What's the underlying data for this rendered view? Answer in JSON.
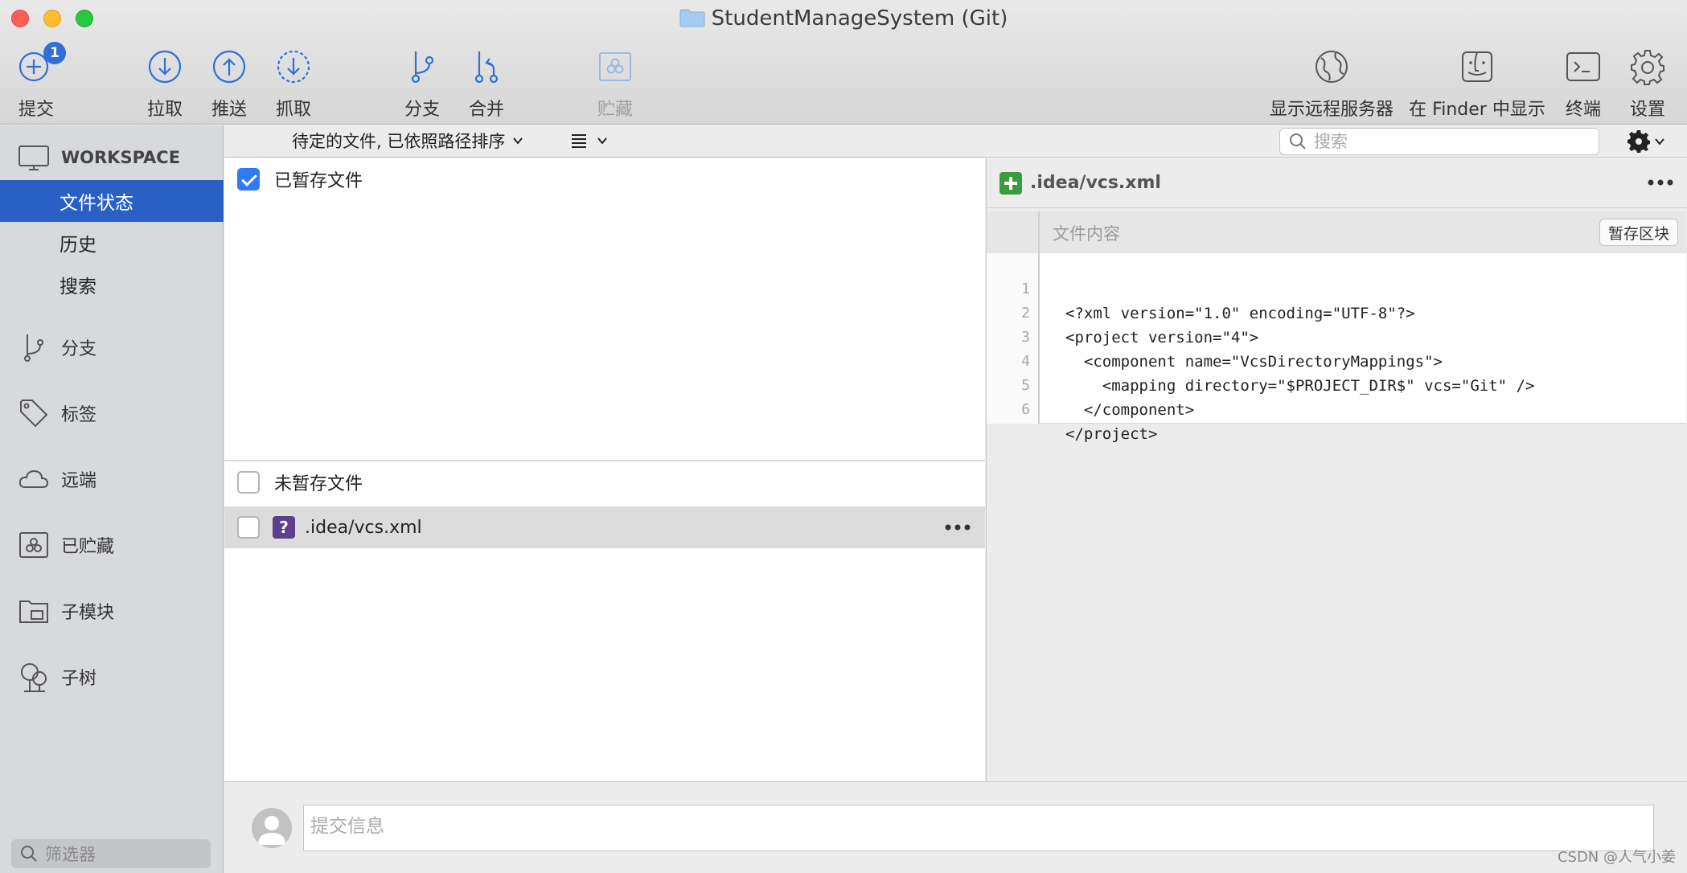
{
  "window": {
    "title": "StudentManageSystem (Git)"
  },
  "toolbar": {
    "commit": {
      "label": "提交",
      "badge": "1"
    },
    "pull": {
      "label": "拉取"
    },
    "push": {
      "label": "推送"
    },
    "fetch": {
      "label": "抓取"
    },
    "branch": {
      "label": "分支"
    },
    "merge": {
      "label": "合并"
    },
    "stash": {
      "label": "贮藏"
    },
    "show_remote": {
      "label": "显示远程服务器"
    },
    "show_in_finder": {
      "label": "在 Finder 中显示"
    },
    "terminal": {
      "label": "终端"
    },
    "settings": {
      "label": "设置"
    }
  },
  "sidebar": {
    "workspace": {
      "label": "WORKSPACE"
    },
    "workspace_items": [
      {
        "label": "文件状态"
      },
      {
        "label": "历史"
      },
      {
        "label": "搜索"
      }
    ],
    "sections": [
      {
        "label": "分支"
      },
      {
        "label": "标签"
      },
      {
        "label": "远端"
      },
      {
        "label": "已贮藏"
      },
      {
        "label": "子模块"
      },
      {
        "label": "子树"
      }
    ],
    "filter_placeholder": "筛选器"
  },
  "subbar": {
    "sort_label": "待定的文件, 已依照路径排序",
    "search_placeholder": "搜索"
  },
  "staged": {
    "header": "已暂存文件"
  },
  "unstaged": {
    "header": "未暂存文件",
    "files": [
      {
        "name": ".idea/vcs.xml"
      }
    ]
  },
  "diff": {
    "file": ".idea/vcs.xml",
    "hunk_title": "文件内容",
    "hunk_button": "暂存区块",
    "lines": [
      {
        "n": "1",
        "text": "<?xml version=\"1.0\" encoding=\"UTF-8\"?>"
      },
      {
        "n": "2",
        "text": "<project version=\"4\">"
      },
      {
        "n": "3",
        "text": "  <component name=\"VcsDirectoryMappings\">"
      },
      {
        "n": "4",
        "text": "    <mapping directory=\"$PROJECT_DIR$\" vcs=\"Git\" />"
      },
      {
        "n": "5",
        "text": "  </component>"
      },
      {
        "n": "6",
        "text": "</project>"
      }
    ]
  },
  "commit": {
    "placeholder": "提交信息"
  },
  "watermark": "CSDN @人气小姜",
  "colors": {
    "accent": "#2a5fc4",
    "icon_blue": "#2f6fd6",
    "added_green": "#3b9c3e",
    "untracked_purple": "#5b3e8c"
  }
}
